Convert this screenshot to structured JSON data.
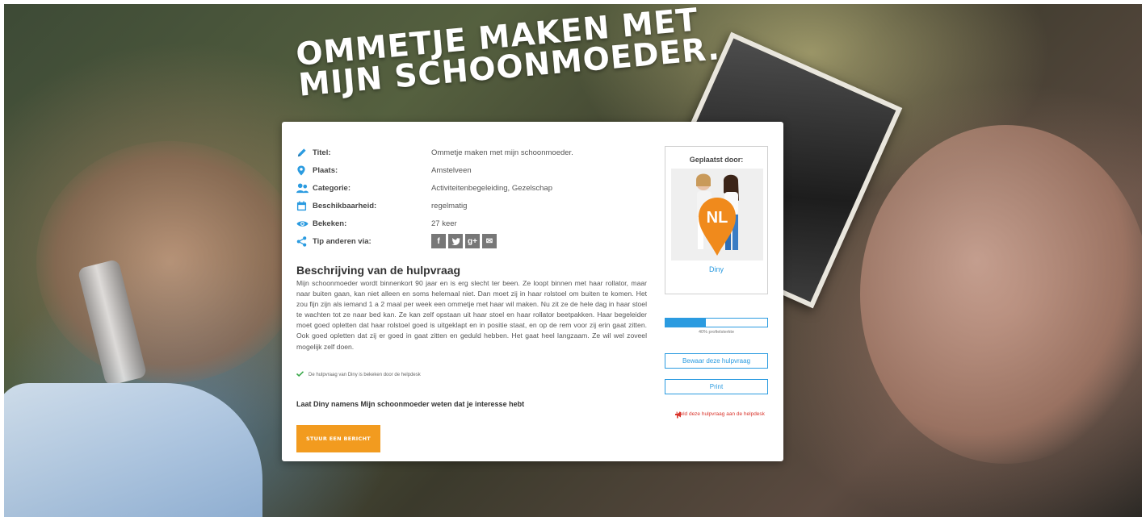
{
  "hero": {
    "title": "OMMETJE MAKEN MET MIJN SCHOONMOEDER."
  },
  "details": {
    "rows": [
      {
        "label": "Titel:",
        "value": "Ommetje maken met mijn schoonmoeder."
      },
      {
        "label": "Plaats:",
        "value": "Amstelveen"
      },
      {
        "label": "Categorie:",
        "value": "Activiteitenbegeleiding, Gezelschap"
      },
      {
        "label": "Beschikbaarheid:",
        "value": "regelmatig"
      },
      {
        "label": "Bekeken:",
        "value": "27 keer"
      },
      {
        "label": "Tip anderen via:",
        "value": ""
      }
    ],
    "share": [
      {
        "icon": "facebook-icon",
        "glyph": "f"
      },
      {
        "icon": "twitter-icon",
        "glyph": "t"
      },
      {
        "icon": "google-plus-icon",
        "glyph": "g+"
      },
      {
        "icon": "email-icon",
        "glyph": "✉"
      }
    ]
  },
  "description": {
    "title": "Beschrijving van de hulpvraag",
    "text": "Mijn schoonmoeder wordt binnenkort 90 jaar en is erg slecht ter been. Ze loopt binnen met haar rollator, maar naar buiten gaan, kan niet alleen en soms helemaal niet. Dan moet zij in haar rolstoel om buiten te komen. Het zou fijn zijn als iemand 1 a 2 maal per week een ommetje met haar wil maken. Nu zit ze de hele dag in haar stoel te wachten tot ze naar bed kan. Ze kan zelf opstaan uit haar stoel en haar rollator beetpakken. Haar begeleider moet goed opletten dat haar rolstoel goed is uitgeklapt en in positie staat, en op de rem voor zij erin gaat zitten. Ook goed opletten dat zij er goed in gaat zitten en geduld hebben. Het gaat heel langzaam. Ze wil wel zoveel mogelijk zelf doen.",
    "reviewed": "De hulpvraag van Diny is bekeken door de helpdesk"
  },
  "contact": {
    "prompt": "Laat Diny namens Mijn schoonmoeder weten dat je interesse hebt",
    "button": "STUUR EEN BERICHT"
  },
  "poster": {
    "title": "Geplaatst door:",
    "name": "Diny",
    "badge": "NL"
  },
  "profile": {
    "strength": 40,
    "label": "40% profielsterkte"
  },
  "actions": {
    "save": "Bewaar deze hulpvraag",
    "print": "Print",
    "report": "Meld deze hulpvraag aan de helpdesk"
  },
  "colors": {
    "accent": "#2b9be0",
    "cta": "#f29b1f",
    "report": "#d9342b",
    "check": "#3aa84a"
  }
}
